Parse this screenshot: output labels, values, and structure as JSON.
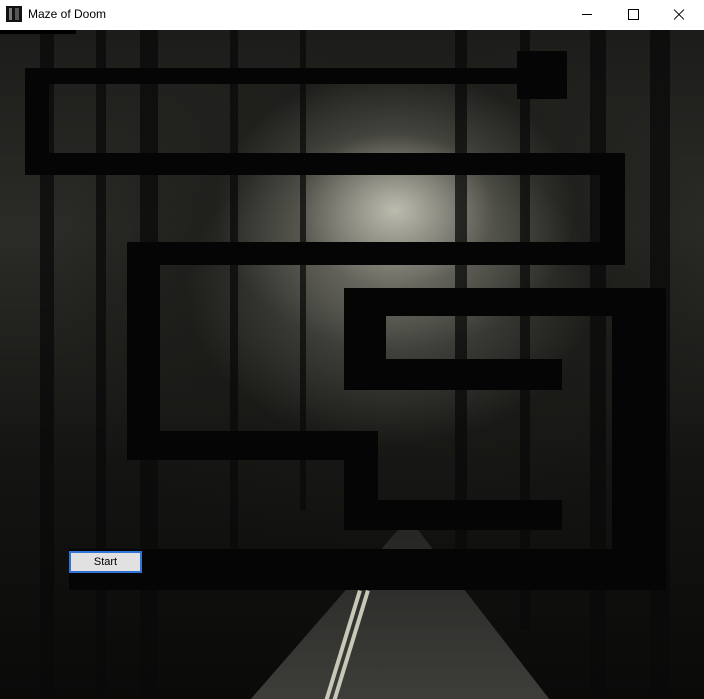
{
  "window": {
    "title": "Maze of Doom"
  },
  "titlebar_icons": [
    "app-icon",
    "minimize-icon",
    "maximize-icon",
    "close-icon"
  ],
  "start_button": {
    "label": "Start"
  }
}
